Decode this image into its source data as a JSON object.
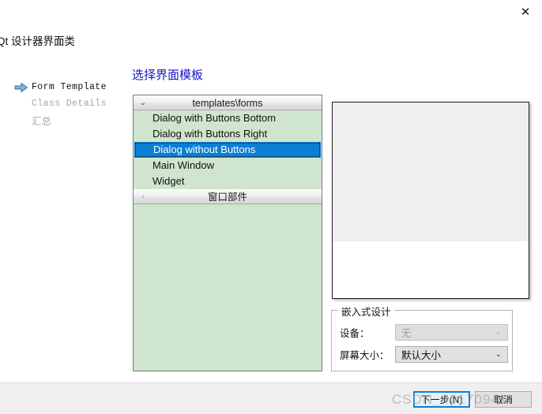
{
  "window": {
    "title": "Qt 设计器界面类",
    "close_icon": "close-icon",
    "close_glyph": "✕"
  },
  "steps": {
    "items": [
      {
        "label": "Form Template",
        "state": "active"
      },
      {
        "label": "Class Details",
        "state": "inactive"
      },
      {
        "label": "汇总",
        "state": "inactive"
      }
    ]
  },
  "page": {
    "heading": "选择界面模板",
    "heading_color": "#1414c8"
  },
  "template_list": {
    "groups": [
      {
        "header": "templates\\forms",
        "chevron": "chevron-down-icon",
        "chevron_glyph": "⌄",
        "expanded": true,
        "items": [
          {
            "label": "Dialog with Buttons Bottom",
            "selected": false
          },
          {
            "label": "Dialog with Buttons Right",
            "selected": false
          },
          {
            "label": "Dialog without Buttons",
            "selected": true
          },
          {
            "label": "Main Window",
            "selected": false
          },
          {
            "label": "Widget",
            "selected": false
          }
        ]
      },
      {
        "header": "窗口部件",
        "chevron": "chevron-right-icon",
        "chevron_glyph": "›",
        "expanded": false,
        "items": []
      }
    ],
    "selection_color": "#0b7fd4",
    "background_color": "#cfe5cd"
  },
  "preview": {
    "name": "template-preview",
    "body_color": "#efefef",
    "base_color": "#ffffff"
  },
  "embedded_design": {
    "legend": "嵌入式设计",
    "fields": [
      {
        "label": "设备：",
        "value": "无",
        "disabled": true,
        "chevron_glyph": "⌄"
      },
      {
        "label": "屏幕大小：",
        "value": "默认大小",
        "disabled": false,
        "chevron_glyph": "⌄"
      }
    ]
  },
  "footer": {
    "next_label": "下一步(N)",
    "cancel_label": "取消",
    "default_button_border": "#0b7fd4"
  },
  "watermark": {
    "text": "CSDN_40170941"
  }
}
